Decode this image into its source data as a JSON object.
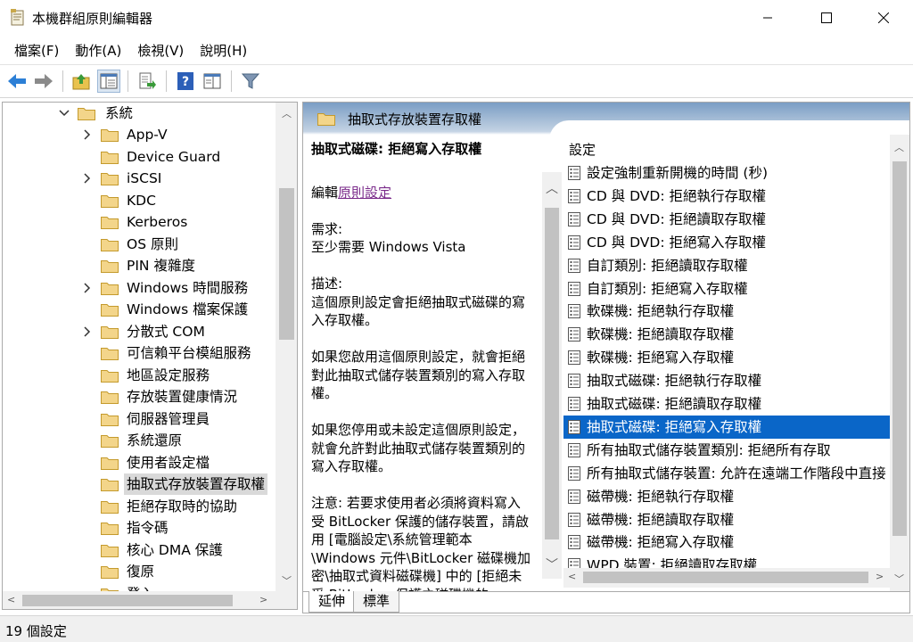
{
  "window": {
    "title": "本機群組原則編輯器"
  },
  "menu": [
    "檔案(F)",
    "動作(A)",
    "檢視(V)",
    "說明(H)"
  ],
  "toolbar": {
    "icons": [
      "back-arrow-icon",
      "forward-arrow-icon",
      "up-folder-icon",
      "show-hide-tree-icon",
      "export-list-icon",
      "help-icon",
      "extended-view-icon",
      "filter-icon"
    ]
  },
  "tree": {
    "parent": "系統",
    "items": [
      {
        "label": "App-V",
        "expandable": true
      },
      {
        "label": "Device Guard",
        "expandable": false
      },
      {
        "label": "iSCSI",
        "expandable": true
      },
      {
        "label": "KDC",
        "expandable": false
      },
      {
        "label": "Kerberos",
        "expandable": false
      },
      {
        "label": "OS 原則",
        "expandable": false
      },
      {
        "label": "PIN 複雜度",
        "expandable": false
      },
      {
        "label": "Windows 時間服務",
        "expandable": true
      },
      {
        "label": "Windows 檔案保護",
        "expandable": false
      },
      {
        "label": "分散式 COM",
        "expandable": true
      },
      {
        "label": "可信賴平台模組服務",
        "expandable": false
      },
      {
        "label": "地區設定服務",
        "expandable": false
      },
      {
        "label": "存放裝置健康情況",
        "expandable": false
      },
      {
        "label": "伺服器管理員",
        "expandable": false
      },
      {
        "label": "系統還原",
        "expandable": false
      },
      {
        "label": "使用者設定檔",
        "expandable": false
      },
      {
        "label": "抽取式存放裝置存取權",
        "expandable": false,
        "selected": true
      },
      {
        "label": "拒絕存取時的協助",
        "expandable": false
      },
      {
        "label": "指令碼",
        "expandable": false
      },
      {
        "label": "核心 DMA 保護",
        "expandable": false
      },
      {
        "label": "復原",
        "expandable": false
      },
      {
        "label": "登入",
        "expandable": false
      }
    ]
  },
  "right": {
    "header": "抽取式存放裝置存取權",
    "description": {
      "policy_title": "抽取式磁碟: 拒絕寫入存取權",
      "edit_prefix": "編輯",
      "edit_link": "原則設定",
      "requirement_label": "需求:",
      "requirement_value": "至少需要 Windows Vista",
      "description_label": "描述:",
      "description_value": "這個原則設定會拒絕抽取式磁碟的寫入存取權。",
      "enabled_text": "如果您啟用這個原則設定，就會拒絕對此抽取式儲存裝置類別的寫入存取權。",
      "disabled_text": "如果您停用或未設定這個原則設定，就會允許對此抽取式儲存裝置類別的寫入存取權。",
      "note_text": "注意: 若要求使用者必須將資料寫入受 BitLocker 保護的儲存裝置，請啟用 [電腦設定\\系統管理範本\\Windows 元件\\BitLocker 磁碟機加密\\抽取式資料磁碟機] 中的 [拒絕未受 BitLocker 保護之磁碟機的"
    },
    "list_header": "設定",
    "settings": [
      "設定強制重新開機的時間 (秒)",
      "CD 與 DVD: 拒絕執行存取權",
      "CD 與 DVD: 拒絕讀取存取權",
      "CD 與 DVD: 拒絕寫入存取權",
      "自訂類別: 拒絕讀取存取權",
      "自訂類別: 拒絕寫入存取權",
      "軟碟機: 拒絕執行存取權",
      "軟碟機: 拒絕讀取存取權",
      "軟碟機: 拒絕寫入存取權",
      "抽取式磁碟: 拒絕執行存取權",
      "抽取式磁碟: 拒絕讀取存取權",
      "抽取式磁碟: 拒絕寫入存取權",
      "所有抽取式儲存裝置類別: 拒絕所有存取",
      "所有抽取式儲存裝置: 允許在遠端工作階段中直接",
      "磁帶機: 拒絕執行存取權",
      "磁帶機: 拒絕讀取存取權",
      "磁帶機: 拒絕寫入存取權",
      "WPD 裝置: 拒絕讀取存取權"
    ],
    "selected_setting": 11,
    "tabs": [
      "延伸",
      "標準"
    ]
  },
  "status": {
    "text": "19 個設定"
  },
  "colors": {
    "selection": "#0a66c8",
    "tree_selection": "#d9d9d9",
    "header_gradient_top": "#7a9dc4",
    "link": "#7a2a8a"
  }
}
